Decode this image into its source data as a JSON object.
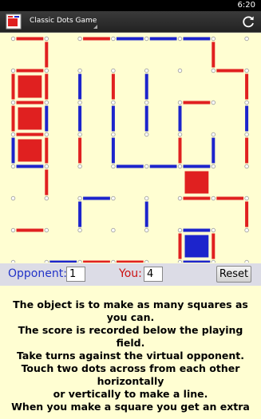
{
  "status_bar": {
    "time": "6:20"
  },
  "action_bar": {
    "title": "Classic Dots Game",
    "app_icon": "dots-game-icon",
    "refresh_icon": "refresh-icon"
  },
  "colors": {
    "red": "#e02020",
    "blue": "#1c24cc",
    "background": "#fffed2",
    "score_bar": "#dcdce6"
  },
  "board": {
    "cols": 8,
    "rows": 7,
    "h_lines": [
      {
        "col": 0,
        "row": 0,
        "color": "red"
      },
      {
        "col": 2,
        "row": 0,
        "color": "red"
      },
      {
        "col": 3,
        "row": 0,
        "color": "blue"
      },
      {
        "col": 4,
        "row": 0,
        "color": "blue"
      },
      {
        "col": 5,
        "row": 0,
        "color": "blue"
      },
      {
        "col": 0,
        "row": 1,
        "color": "red"
      },
      {
        "col": 0,
        "row": 2,
        "color": "red"
      },
      {
        "col": 6,
        "row": 1,
        "color": "red"
      },
      {
        "col": 0,
        "row": 3,
        "color": "red"
      },
      {
        "col": 5,
        "row": 2,
        "color": "red"
      },
      {
        "col": 0,
        "row": 4,
        "color": "blue"
      },
      {
        "col": 3,
        "row": 4,
        "color": "blue"
      },
      {
        "col": 4,
        "row": 4,
        "color": "blue"
      },
      {
        "col": 5,
        "row": 4,
        "color": "blue"
      },
      {
        "col": 5,
        "row": 5,
        "color": "red"
      },
      {
        "col": 0,
        "row": 6,
        "color": "red"
      },
      {
        "col": 2,
        "row": 5,
        "color": "blue"
      },
      {
        "col": 6,
        "row": 5,
        "color": "red"
      },
      {
        "col": 1,
        "row": 7,
        "color": "blue"
      },
      {
        "col": 2,
        "row": 7,
        "color": "red"
      },
      {
        "col": 3,
        "row": 7,
        "color": "red"
      },
      {
        "col": 5,
        "row": 6,
        "color": "blue"
      },
      {
        "col": 5,
        "row": 7,
        "color": "blue"
      }
    ],
    "v_lines": [
      {
        "col": 1,
        "row": 0,
        "color": "red"
      },
      {
        "col": 6,
        "row": 0,
        "color": "red"
      },
      {
        "col": 0,
        "row": 1,
        "color": "red"
      },
      {
        "col": 1,
        "row": 1,
        "color": "red"
      },
      {
        "col": 2,
        "row": 1,
        "color": "blue"
      },
      {
        "col": 3,
        "row": 1,
        "color": "red"
      },
      {
        "col": 4,
        "row": 1,
        "color": "blue"
      },
      {
        "col": 7,
        "row": 1,
        "color": "red"
      },
      {
        "col": 0,
        "row": 2,
        "color": "red"
      },
      {
        "col": 1,
        "row": 2,
        "color": "blue"
      },
      {
        "col": 2,
        "row": 2,
        "color": "blue"
      },
      {
        "col": 3,
        "row": 2,
        "color": "blue"
      },
      {
        "col": 4,
        "row": 2,
        "color": "blue"
      },
      {
        "col": 5,
        "row": 2,
        "color": "blue"
      },
      {
        "col": 7,
        "row": 2,
        "color": "blue"
      },
      {
        "col": 0,
        "row": 3,
        "color": "blue"
      },
      {
        "col": 1,
        "row": 3,
        "color": "red"
      },
      {
        "col": 2,
        "row": 3,
        "color": "red"
      },
      {
        "col": 3,
        "row": 3,
        "color": "blue"
      },
      {
        "col": 5,
        "row": 3,
        "color": "red"
      },
      {
        "col": 6,
        "row": 3,
        "color": "blue"
      },
      {
        "col": 7,
        "row": 3,
        "color": "red"
      },
      {
        "col": 1,
        "row": 4,
        "color": "red"
      },
      {
        "col": 2,
        "row": 5,
        "color": "blue"
      },
      {
        "col": 4,
        "row": 5,
        "color": "blue"
      },
      {
        "col": 5,
        "row": 6,
        "color": "red"
      },
      {
        "col": 6,
        "row": 6,
        "color": "red"
      },
      {
        "col": 7,
        "row": 5,
        "color": "red"
      }
    ],
    "boxes": [
      {
        "col": 0,
        "row": 1,
        "color": "red"
      },
      {
        "col": 0,
        "row": 2,
        "color": "red"
      },
      {
        "col": 0,
        "row": 3,
        "color": "red"
      },
      {
        "col": 5,
        "row": 4,
        "color": "red"
      },
      {
        "col": 5,
        "row": 6,
        "color": "blue"
      }
    ]
  },
  "score": {
    "opponent_label": "Opponent:",
    "opponent_value": "1",
    "you_label": "You:",
    "you_value": "4",
    "reset_label": "Reset"
  },
  "instructions": [
    "The object is to make as many squares as",
    "you can.",
    "The score is recorded below the playing",
    "field.",
    "Take turns against the virtual opponent.",
    "Touch two dots across from each other",
    "horizontally",
    "or vertically to make a line.",
    "When you make a square you get an extra"
  ]
}
